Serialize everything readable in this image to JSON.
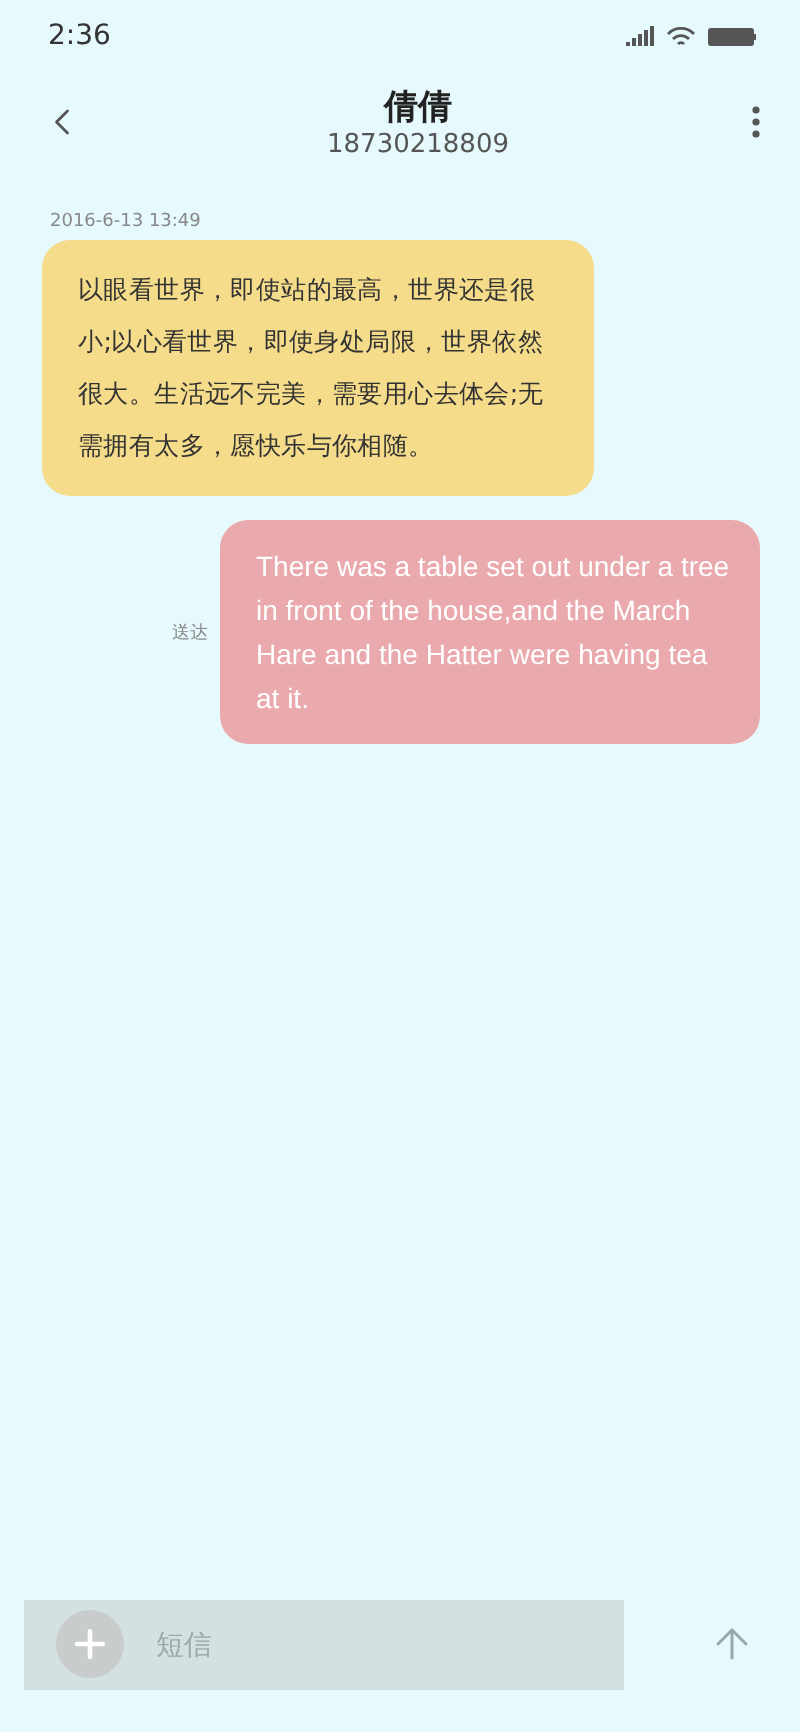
{
  "status_bar": {
    "time": "2:36"
  },
  "header": {
    "name": "倩倩",
    "phone": "18730218809"
  },
  "messages": [
    {
      "kind": "incoming",
      "timestamp": "2016-6-13 13:49",
      "text": "以眼看世界，即使站的最高，世界还是很小;以心看世界，即使身处局限，世界依然很大。生活远不完美，需要用心去体会;无需拥有太多，愿快乐与你相随。"
    },
    {
      "kind": "outgoing",
      "status": "送达",
      "text": "There was a table set out under a tree in front of the house,and the March Hare and the Hatter were having tea at it."
    }
  ],
  "composer": {
    "placeholder": "短信"
  }
}
